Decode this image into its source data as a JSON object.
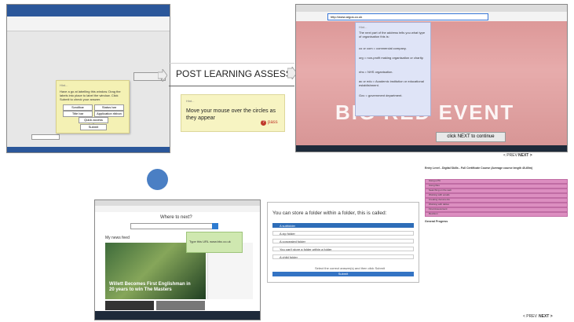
{
  "title": "POST LEARNING ASSESSMENT",
  "word_window": {
    "popup_title": "Hint...",
    "popup_text": "Have a go at labelling this window. Drag the labels into place to label the window. Click Submit to check your answer.",
    "options": [
      "Scrollbar",
      "Status bar",
      "Title bar",
      "Application ribbon",
      "Quick access toolbar"
    ],
    "submit_label": "Submit"
  },
  "hint_box": {
    "title": "Hint...",
    "text": "Move your mouse over the circles as they appear",
    "pass_label": "pass"
  },
  "argos_window": {
    "url": "http://www.argos.co.uk",
    "tooltip_title": "Hint...",
    "tooltip_intro": "The next part of the address tells you what type of organisation this is:",
    "tooltip_items": [
      "co or com = commercial company.",
      "org = non-profit making organisation or charity.",
      "nhs = NHS organisation.",
      "ac or edu = Academic institution or educational establishment.",
      "Gov = government department."
    ],
    "banner": "BIG RED EVENT",
    "next_label": "click NEXT to continue"
  },
  "edge_window": {
    "heading": "Where to next?",
    "feed_title": "My news feed",
    "headline": "Willett Becomes First Englishman in 20 years to win The Masters",
    "green_tip": "Type this URL www.bbc.co.uk"
  },
  "quiz": {
    "question": "You can store a folder within a folder, this is called:",
    "options": [
      "A subfolder",
      "A zip folder",
      "A concealed folder",
      "You can't store a folder within a folder",
      "A child folder"
    ],
    "instruction": "Select the correct answer(s) and then click Submit",
    "submit_label": "Submit"
  },
  "course": {
    "header": "Entry Level - Digital Skills - Full Certificate Course (Average course length 40-60m)",
    "rows": [
      "Using a PC",
      "Using files",
      "Searching on the web",
      "Working with emails",
      "Creating documents",
      "Working with tables",
      "Final Assessment",
      "Revision"
    ],
    "section": "General Progress"
  },
  "nav": {
    "prev": "< PREV",
    "next": "NEXT >"
  }
}
